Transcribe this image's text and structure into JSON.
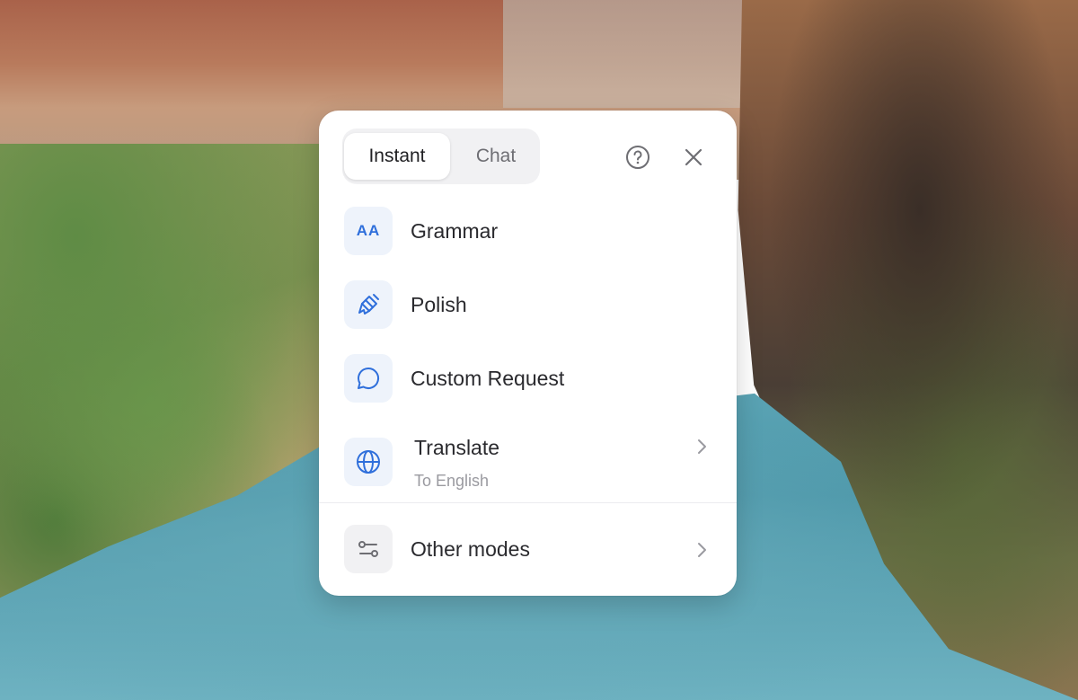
{
  "tabs": {
    "instant": "Instant",
    "chat": "Chat"
  },
  "icons": {
    "help": "help-circle-icon",
    "close": "close-icon",
    "grammar": "grammar-aa-icon",
    "grammar_glyph": "AA",
    "polish": "brush-icon",
    "custom_request": "chat-bubble-icon",
    "translate": "globe-icon",
    "other_modes": "sliders-icon",
    "chevron": "chevron-right-icon"
  },
  "menu": {
    "grammar": "Grammar",
    "polish": "Polish",
    "custom_request": "Custom Request",
    "translate": "Translate",
    "translate_target": "To English",
    "other_modes": "Other modes"
  },
  "colors": {
    "accent": "#2f6fdb",
    "panel_bg": "#ffffff",
    "icon_tile_blue": "#eef3fb",
    "icon_tile_gray": "#f1f1f3"
  }
}
